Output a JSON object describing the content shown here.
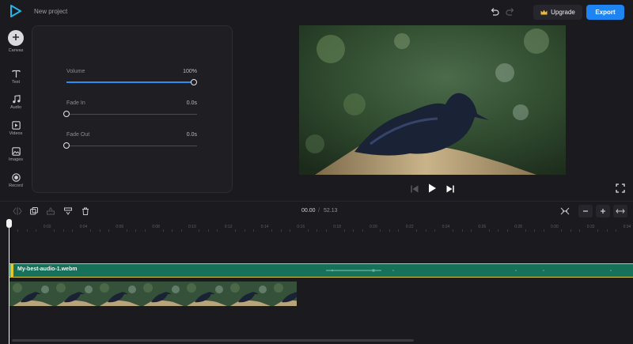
{
  "header": {
    "project_title": "New project",
    "upgrade_label": "Upgrade",
    "export_label": "Export"
  },
  "sidebar": {
    "items": [
      {
        "label": "Canvas"
      },
      {
        "label": "Text"
      },
      {
        "label": "Audio"
      },
      {
        "label": "Videos"
      },
      {
        "label": "Images"
      },
      {
        "label": "Record"
      }
    ]
  },
  "audio_panel": {
    "volume": {
      "label": "Volume",
      "value": "100%",
      "level": 1.0
    },
    "fade_in": {
      "label": "Fade In",
      "value": "0.0s",
      "level": 0.0
    },
    "fade_out": {
      "label": "Fade Out",
      "value": "0.0s",
      "level": 0.0
    }
  },
  "timeline": {
    "current_time": "00.00",
    "separator": "/",
    "total_time": "52.13",
    "ticks": [
      "0",
      "0:02",
      "0:04",
      "0:06",
      "0:08",
      "0:10",
      "0:12",
      "0:14",
      "0:16",
      "0:18",
      "0:20",
      "0:22",
      "0:24",
      "0:26",
      "0:28",
      "0:30",
      "0:32",
      "0:34"
    ],
    "audio_clip_name": "My-best-audio-1.webm",
    "video_thumbnail_count": 7
  },
  "colors": {
    "accent": "#1d84f2",
    "audio_track": "#16705a",
    "audio_border": "#d9c43a"
  }
}
